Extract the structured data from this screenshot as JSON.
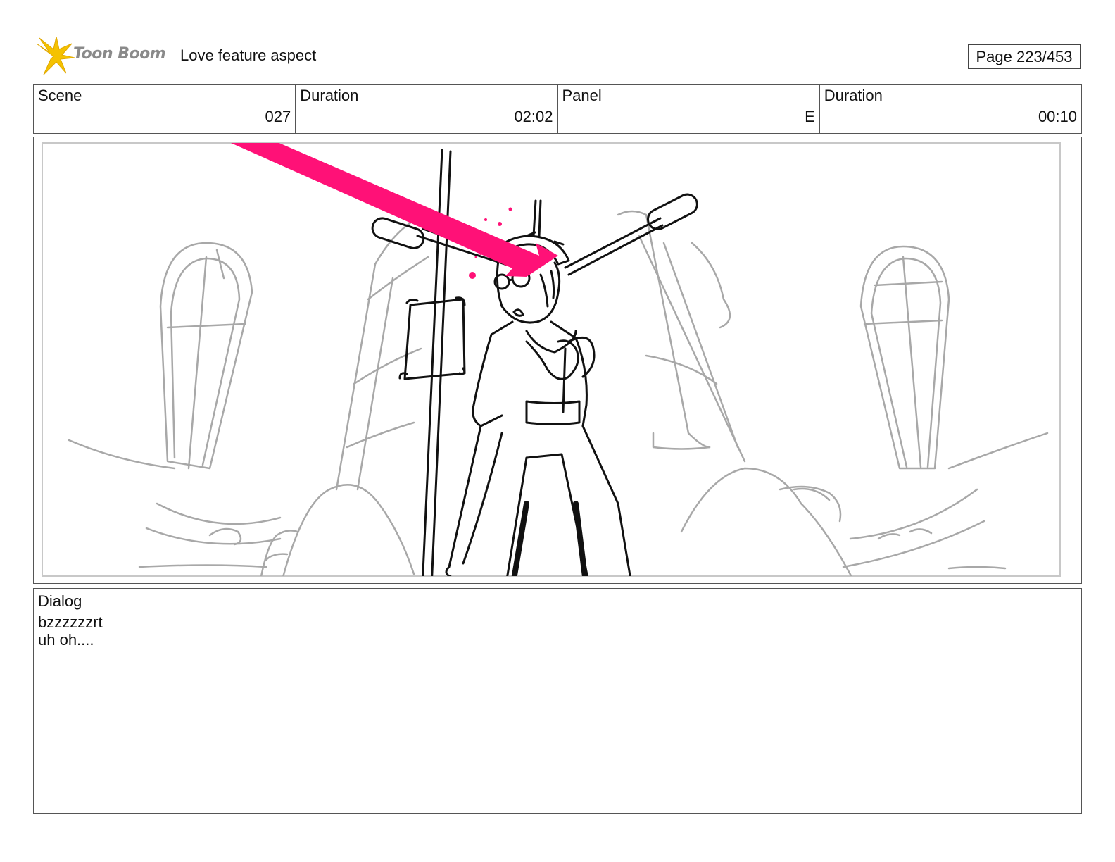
{
  "header": {
    "logo_text": "Toon Boom",
    "project_title": "Love feature aspect",
    "page_indicator": "Page 223/453"
  },
  "info": {
    "scene_label": "Scene",
    "scene_value": "027",
    "scene_duration_label": "Duration",
    "scene_duration_value": "02:02",
    "panel_label": "Panel",
    "panel_value": "E",
    "panel_duration_label": "Duration",
    "panel_duration_value": "00:10"
  },
  "dialog": {
    "label": "Dialog",
    "lines": [
      "bzzzzzzrt",
      "uh oh...."
    ]
  },
  "colors": {
    "arrow": "#ff1177",
    "logo_yellow": "#f5c200",
    "sketch_gray": "#a0a0a0",
    "ink": "#111111"
  }
}
